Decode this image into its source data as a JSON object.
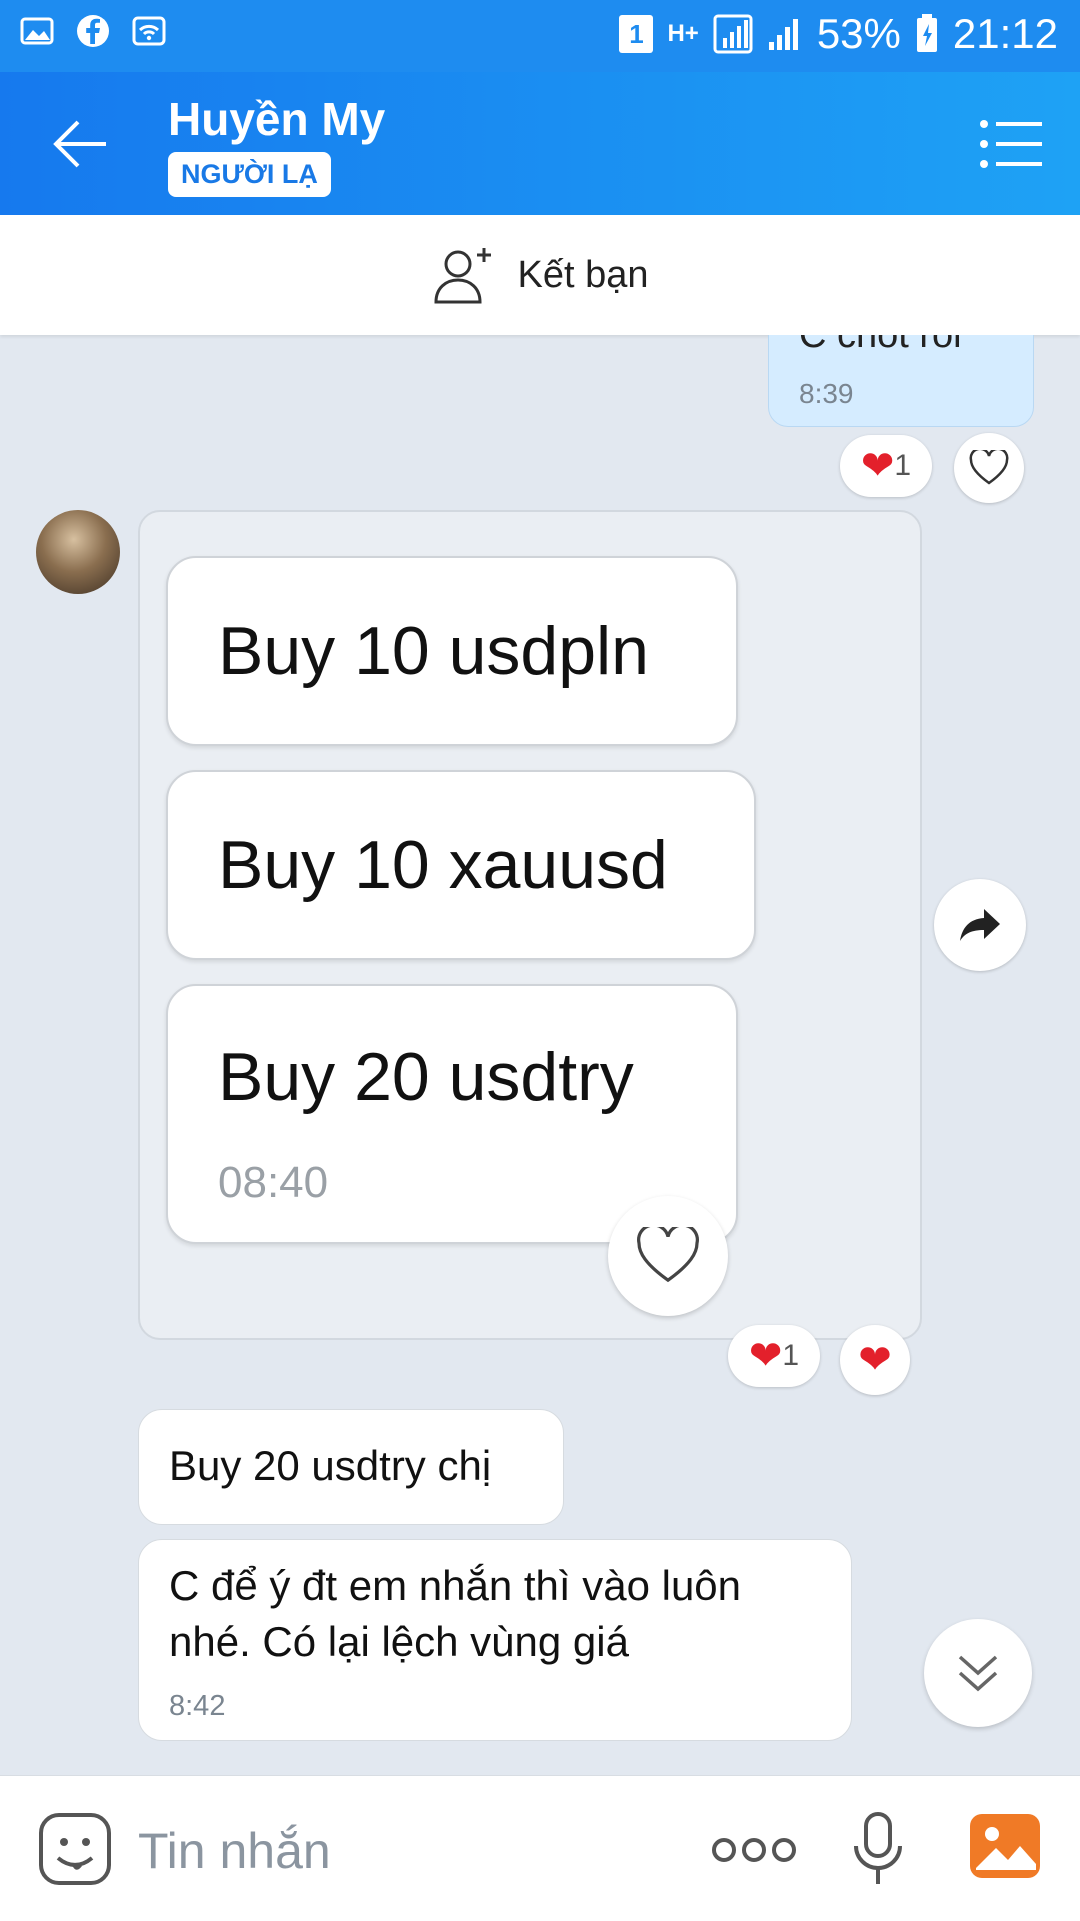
{
  "status_bar": {
    "sim_slot": "1",
    "network": "H+",
    "battery": "53%",
    "time": "21:12",
    "left_icons": [
      "image-icon",
      "facebook-icon",
      "wifi-icon"
    ]
  },
  "header": {
    "name": "Huyền My",
    "tag": "NGƯỜI LẠ"
  },
  "friend_bar": {
    "label": "Kết bạn"
  },
  "messages": {
    "previous": {
      "text": "C chốt rồi",
      "time": "8:39",
      "reaction_count": "1"
    },
    "image_card": {
      "lines": [
        "Buy 10 usdpln",
        "Buy 10 xauusd",
        "Buy 20 usdtry"
      ],
      "time": "08:40",
      "reaction_count": "1"
    },
    "text1": "Buy 20 usdtry chị",
    "text2": "C để ý đt em nhắn thì vào luôn nhé. Có lại lệch vùng giá",
    "text2_time": "8:42"
  },
  "input": {
    "placeholder": "Tin nhắn"
  },
  "colors": {
    "header_start": "#1679ee",
    "header_end": "#1ea2f5",
    "chat_background": "#e2e8f0",
    "sent_bubble": "#d5ecff",
    "heart": "#e3202b"
  }
}
